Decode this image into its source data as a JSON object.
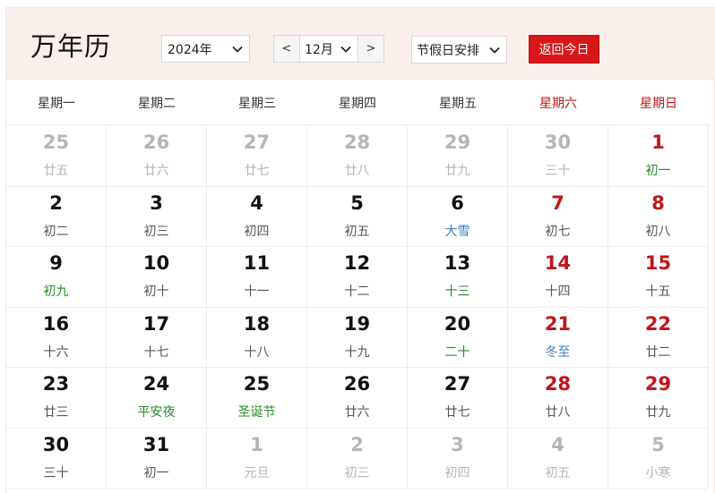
{
  "app_title": "万年历",
  "controls": {
    "year_value": "2024年",
    "prev_month": "<",
    "month_value": "12月",
    "next_month": ">",
    "holiday_value": "节假日安排",
    "today_button": "返回今日"
  },
  "colors": {
    "accent_red": "#d9171a",
    "weekend_red": "#c0161a",
    "festival_green": "#2a8a2a",
    "solar_term_blue": "#3a7fc0",
    "toolbar_bg": "#fbefec"
  },
  "weekdays": [
    "星期一",
    "星期二",
    "星期三",
    "星期四",
    "星期五",
    "星期六",
    "星期日"
  ],
  "days": [
    {
      "day": "25",
      "lunar": "廿五",
      "other": true,
      "weekend": false,
      "tag": ""
    },
    {
      "day": "26",
      "lunar": "廿六",
      "other": true,
      "weekend": false,
      "tag": ""
    },
    {
      "day": "27",
      "lunar": "廿七",
      "other": true,
      "weekend": false,
      "tag": ""
    },
    {
      "day": "28",
      "lunar": "廿八",
      "other": true,
      "weekend": false,
      "tag": ""
    },
    {
      "day": "29",
      "lunar": "廿九",
      "other": true,
      "weekend": false,
      "tag": ""
    },
    {
      "day": "30",
      "lunar": "三十",
      "other": true,
      "weekend": true,
      "tag": ""
    },
    {
      "day": "1",
      "lunar": "初一",
      "other": false,
      "weekend": true,
      "tag": "green"
    },
    {
      "day": "2",
      "lunar": "初二",
      "other": false,
      "weekend": false,
      "tag": ""
    },
    {
      "day": "3",
      "lunar": "初三",
      "other": false,
      "weekend": false,
      "tag": ""
    },
    {
      "day": "4",
      "lunar": "初四",
      "other": false,
      "weekend": false,
      "tag": ""
    },
    {
      "day": "5",
      "lunar": "初五",
      "other": false,
      "weekend": false,
      "tag": ""
    },
    {
      "day": "6",
      "lunar": "大雪",
      "other": false,
      "weekend": false,
      "tag": "blue"
    },
    {
      "day": "7",
      "lunar": "初七",
      "other": false,
      "weekend": true,
      "tag": ""
    },
    {
      "day": "8",
      "lunar": "初八",
      "other": false,
      "weekend": true,
      "tag": ""
    },
    {
      "day": "9",
      "lunar": "初九",
      "other": false,
      "weekend": false,
      "tag": "green"
    },
    {
      "day": "10",
      "lunar": "初十",
      "other": false,
      "weekend": false,
      "tag": ""
    },
    {
      "day": "11",
      "lunar": "十一",
      "other": false,
      "weekend": false,
      "tag": ""
    },
    {
      "day": "12",
      "lunar": "十二",
      "other": false,
      "weekend": false,
      "tag": ""
    },
    {
      "day": "13",
      "lunar": "十三",
      "other": false,
      "weekend": false,
      "tag": "green"
    },
    {
      "day": "14",
      "lunar": "十四",
      "other": false,
      "weekend": true,
      "tag": ""
    },
    {
      "day": "15",
      "lunar": "十五",
      "other": false,
      "weekend": true,
      "tag": ""
    },
    {
      "day": "16",
      "lunar": "十六",
      "other": false,
      "weekend": false,
      "tag": ""
    },
    {
      "day": "17",
      "lunar": "十七",
      "other": false,
      "weekend": false,
      "tag": ""
    },
    {
      "day": "18",
      "lunar": "十八",
      "other": false,
      "weekend": false,
      "tag": ""
    },
    {
      "day": "19",
      "lunar": "十九",
      "other": false,
      "weekend": false,
      "tag": ""
    },
    {
      "day": "20",
      "lunar": "二十",
      "other": false,
      "weekend": false,
      "tag": "green"
    },
    {
      "day": "21",
      "lunar": "冬至",
      "other": false,
      "weekend": true,
      "tag": "blue"
    },
    {
      "day": "22",
      "lunar": "廿二",
      "other": false,
      "weekend": true,
      "tag": ""
    },
    {
      "day": "23",
      "lunar": "廿三",
      "other": false,
      "weekend": false,
      "tag": ""
    },
    {
      "day": "24",
      "lunar": "平安夜",
      "other": false,
      "weekend": false,
      "tag": "green"
    },
    {
      "day": "25",
      "lunar": "圣诞节",
      "other": false,
      "weekend": false,
      "tag": "green"
    },
    {
      "day": "26",
      "lunar": "廿六",
      "other": false,
      "weekend": false,
      "tag": ""
    },
    {
      "day": "27",
      "lunar": "廿七",
      "other": false,
      "weekend": false,
      "tag": ""
    },
    {
      "day": "28",
      "lunar": "廿八",
      "other": false,
      "weekend": true,
      "tag": ""
    },
    {
      "day": "29",
      "lunar": "廿九",
      "other": false,
      "weekend": true,
      "tag": ""
    },
    {
      "day": "30",
      "lunar": "三十",
      "other": false,
      "weekend": false,
      "tag": ""
    },
    {
      "day": "31",
      "lunar": "初一",
      "other": false,
      "weekend": false,
      "tag": ""
    },
    {
      "day": "1",
      "lunar": "元旦",
      "other": true,
      "weekend": false,
      "tag": ""
    },
    {
      "day": "2",
      "lunar": "初三",
      "other": true,
      "weekend": false,
      "tag": ""
    },
    {
      "day": "3",
      "lunar": "初四",
      "other": true,
      "weekend": false,
      "tag": ""
    },
    {
      "day": "4",
      "lunar": "初五",
      "other": true,
      "weekend": true,
      "tag": ""
    },
    {
      "day": "5",
      "lunar": "小寒",
      "other": true,
      "weekend": true,
      "tag": ""
    }
  ]
}
